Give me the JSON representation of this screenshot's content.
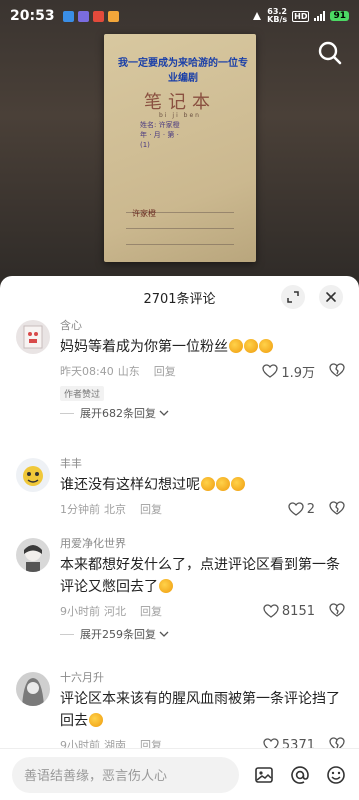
{
  "status": {
    "time": "20:53",
    "net_speed": "63.2",
    "net_unit": "KB/s",
    "hd": "HD",
    "battery": "91"
  },
  "video": {
    "caption": "我一定要成为来哈游的一位专业编剧",
    "notebook_title": "笔记本",
    "notebook_pinyin": "bi ji ben",
    "notebook_lines": [
      "姓名: 许家橙",
      "年 · 月 · 第 ·",
      "(1)"
    ],
    "signature": "许家橙"
  },
  "panel": {
    "title": "2701条评论"
  },
  "comments": [
    {
      "name": "含心",
      "text": "妈妈等着成为你第一位粉丝",
      "time": "昨天08:40",
      "location": "山东",
      "reply": "回复",
      "likes": "1.9万",
      "badge": "作者赞过",
      "expand": "展开682条回复"
    },
    {
      "name": "丰丰",
      "text": "谁还没有这样幻想过呢",
      "time": "1分钟前",
      "location": "北京",
      "reply": "回复",
      "likes": "2"
    },
    {
      "name": "用爱净化世界",
      "text": "本来都想好发什么了，点进评论区看到第一条评论又憋回去了",
      "time": "9小时前",
      "location": "河北",
      "reply": "回复",
      "likes": "8151",
      "expand": "展开259条回复"
    },
    {
      "name": "十六月升",
      "text": "评论区本来该有的腥风血雨被第一条评论挡了回去",
      "time": "9小时前",
      "location": "湖南",
      "reply": "回复",
      "likes": "5371"
    }
  ],
  "input": {
    "placeholder": "善语结善缘，恶言伤人心"
  },
  "icons": [
    "search-icon",
    "expand-icon",
    "close-icon",
    "heart-icon",
    "dislike-icon",
    "image-icon",
    "at-icon",
    "emoji-icon"
  ]
}
